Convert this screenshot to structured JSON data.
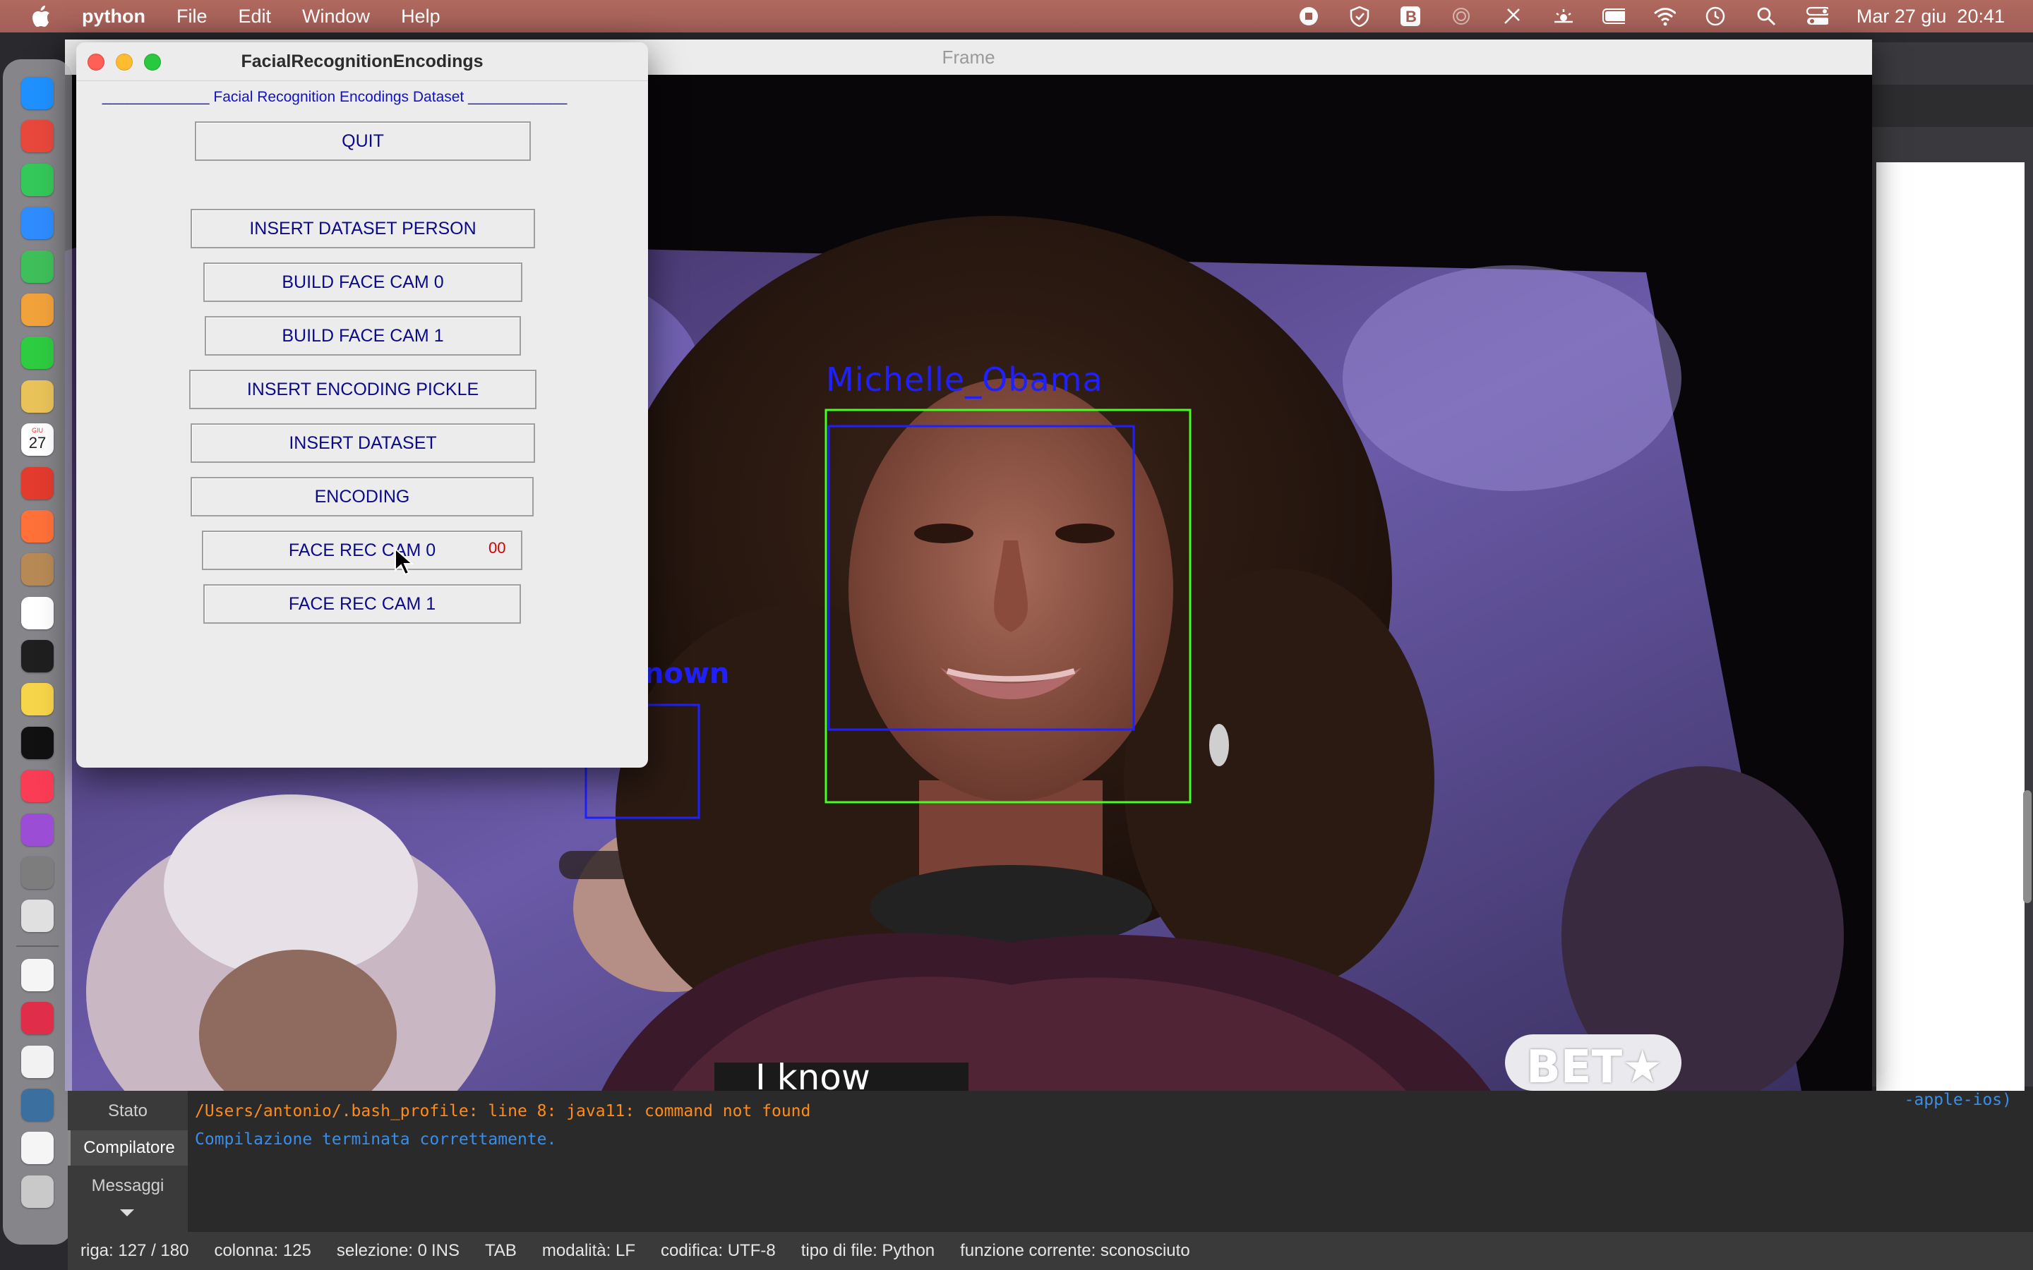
{
  "menubar": {
    "app_name": "python",
    "items": [
      "File",
      "Edit",
      "Window",
      "Help"
    ],
    "datetime": "Mar 27 giu  20:41",
    "status_icons": [
      "stop-icon",
      "vpn-shield-icon",
      "b-app-icon",
      "fingerprint-icon",
      "airdrop-icon",
      "brightness-icon",
      "battery-icon",
      "wifi-icon",
      "time-machine-icon",
      "spotlight-icon",
      "control-center-icon"
    ]
  },
  "dock": {
    "apps": [
      {
        "name": "finder",
        "color": "#1e90ff"
      },
      {
        "name": "launchpad",
        "color": "#e8483b"
      },
      {
        "name": "messages",
        "color": "#34c759"
      },
      {
        "name": "mail",
        "color": "#2f8cff"
      },
      {
        "name": "maps",
        "color": "#3fbf5a"
      },
      {
        "name": "photos",
        "color": "#f2a23a"
      },
      {
        "name": "facetime",
        "color": "#2ecc40"
      },
      {
        "name": "cyberduck",
        "color": "#e9c35a"
      },
      {
        "name": "calendar",
        "color": "#ffffff"
      },
      {
        "name": "chrome",
        "color": "#e33b2e"
      },
      {
        "name": "firefox",
        "color": "#ff7139"
      },
      {
        "name": "contacts",
        "color": "#b78a55"
      },
      {
        "name": "reminders",
        "color": "#ffffff"
      },
      {
        "name": "terminal",
        "color": "#1f1f1f"
      },
      {
        "name": "notes",
        "color": "#f7d54a"
      },
      {
        "name": "apple-tv",
        "color": "#111111"
      },
      {
        "name": "music",
        "color": "#fa3c55"
      },
      {
        "name": "podcasts",
        "color": "#9b4dd6"
      },
      {
        "name": "system-settings",
        "color": "#7d7d7d"
      },
      {
        "name": "preview",
        "color": "#e0e0e0"
      },
      {
        "name": "document",
        "color": "#f5f5f5"
      },
      {
        "name": "photo-booth",
        "color": "#e02d4a"
      },
      {
        "name": "textedit",
        "color": "#f2f2f2"
      },
      {
        "name": "quicktime",
        "color": "#3b6fa0"
      },
      {
        "name": "file",
        "color": "#f5f5f5"
      },
      {
        "name": "trash",
        "color": "#c9c9c9"
      }
    ],
    "calendar_day": "27",
    "calendar_month": "GIU"
  },
  "frame_window": {
    "title": "Frame",
    "overlays": {
      "person_label": "Michelle_Obama",
      "unknown_label": "nown",
      "caption": "I know",
      "watermark": "BET★"
    },
    "box_color_detected": "#2020ff",
    "box_color_tracked": "#44ff22"
  },
  "tk_window": {
    "title": "FacialRecognitionEncodings",
    "heading": "_____________ Facial Recognition Encodings Dataset  ____________",
    "buttons": {
      "quit": "QUIT",
      "insert_dataset_person": "INSERT DATASET PERSON",
      "build_face_cam_0": "BUILD FACE CAM 0",
      "build_face_cam_1": "BUILD FACE CAM 1",
      "insert_encoding_pickle": "INSERT ENCODING PICKLE",
      "insert_dataset": "INSERT DATASET",
      "encoding": "ENCODING",
      "face_rec_cam_0": "FACE REC CAM 0",
      "face_rec_cam_1": "FACE REC CAM 1"
    },
    "counter": "00"
  },
  "bottom_panel": {
    "tabs": [
      "Stato",
      "Compilatore",
      "Messaggi"
    ],
    "active_tab": "Compilatore",
    "truncated_line_end": "-apple-ios)",
    "log": [
      {
        "text": "/Users/antonio/.bash_profile: line 8: java11: command not found",
        "color": "#ff8c1a"
      },
      {
        "text": "Compilazione terminata correttamente.",
        "color": "#3b8ee8"
      }
    ]
  },
  "statusbar": {
    "riga": "riga: 127 / 180",
    "colonna": "colonna: 125",
    "selezione": "selezione: 0",
    "ins": "INS",
    "tab": "TAB",
    "modalita": "modalità: LF",
    "codifica": "codifica: UTF-8",
    "tipo_file": "tipo di file: Python",
    "funzione": "funzione corrente: sconosciuto"
  }
}
